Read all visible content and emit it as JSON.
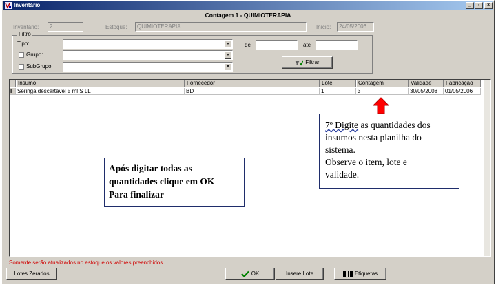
{
  "window": {
    "title": "Inventário",
    "minimize_glyph": "_",
    "restore_glyph": "▫",
    "close_glyph": "×"
  },
  "header": {
    "heading": "Contagem 1 - QUIMIOTERAPIA",
    "inventario_label": "Inventário:",
    "inventario_value": "2",
    "estoque_label": "Estoque:",
    "estoque_value": "QUIMIOTERAPIA",
    "inicio_label": "Início:",
    "inicio_value": "24/05/2006"
  },
  "filter": {
    "legend": "Filtro",
    "tipo_label": "Tipo:",
    "grupo_label": "Grupo:",
    "subgrupo_label": "SubGrupo:",
    "de_label": "de",
    "ate_label": "até",
    "de_value": "",
    "ate_value": "",
    "filter_button": "Filtrar"
  },
  "grid": {
    "columns": [
      "Insumo",
      "Fornecedor",
      "Lote",
      "Contagem",
      "Validade",
      "Fabricação"
    ],
    "rows": [
      {
        "indicator": "I",
        "insumo": "Seringa  descartável 5 ml S LL",
        "fornecedor": "BD",
        "lote": "1",
        "contagem": "3",
        "validade": "30/05/2008",
        "fabricacao": "01/05/2006"
      }
    ]
  },
  "status_text": "Somente serão atualizados no estoque os valores preenchidos.",
  "buttons": {
    "lotes_zerados": "Lotes Zerados",
    "ok": "OK",
    "insere_lote": "Insere Lote",
    "etiquetas": "Etiquetas"
  },
  "annotations": {
    "note_left": [
      "Após digitar todas as",
      "quantidades clique em OK",
      "Para finalizar"
    ],
    "note_right_first_part": "7º Digite",
    "note_right_rest_first_line": " as quantidades dos",
    "note_right_lines": [
      "insumos nesta planilha do",
      "sistema.",
      "Observe o item, lote e",
      "validade."
    ]
  },
  "colors": {
    "titlebar_start": "#0a246a",
    "titlebar_end": "#a6caf0",
    "window_face": "#d4d0c8",
    "status_red": "#d00000",
    "arrow_red": "#ff0000",
    "note_border": "#1f2d6b"
  }
}
